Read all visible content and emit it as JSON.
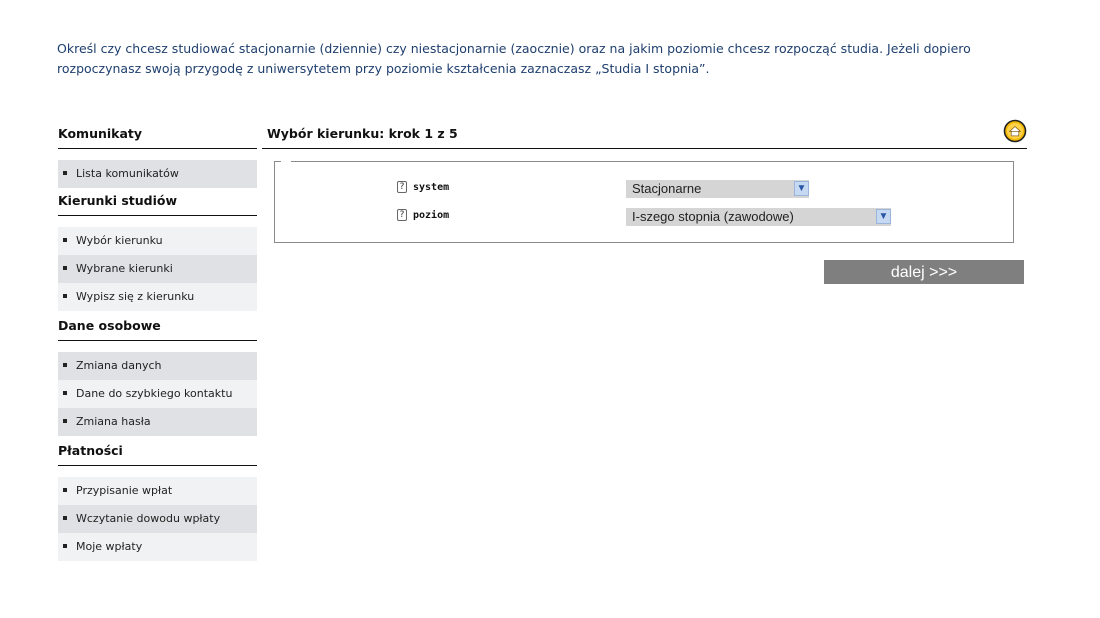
{
  "intro": {
    "line1": "Określ czy chcesz studiować stacjonarnie (dziennie) czy niestacjonarnie (zaocznie) oraz na jakim poziomie chcesz rozpocząć studia. Jeżeli dopiero",
    "line2": "rozpoczynasz swoją przygodę z uniwersytetem przy poziomie kształcenia zaznaczasz „Studia I stopnia”."
  },
  "sidebar": {
    "sections": [
      {
        "title": "Komunikaty",
        "items": [
          "Lista komunikatów"
        ]
      },
      {
        "title": "Kierunki studiów",
        "items": [
          "Wybór kierunku",
          "Wybrane kierunki",
          "Wypisz się z kierunku"
        ]
      },
      {
        "title": "Dane osobowe",
        "items": [
          "Zmiana danych",
          "Dane do szybkiego kontaktu",
          "Zmiana hasła"
        ]
      },
      {
        "title": "Płatności",
        "items": [
          "Przypisanie wpłat",
          "Wczytanie dowodu wpłaty",
          "Moje wpłaty"
        ]
      }
    ]
  },
  "main": {
    "title": "Wybór kierunku: krok 1 z 5",
    "home_icon": "home-icon",
    "help_icon_glyph": "?",
    "fields": {
      "system": {
        "label": "system",
        "value": "Stacjonarne"
      },
      "poziom": {
        "label": "poziom",
        "value": "I-szego stopnia (zawodowe)"
      }
    },
    "next_label": "dalej >>>"
  },
  "colors": {
    "intro_text": "#1f3f6e",
    "nav_dark": "#dfe1e4",
    "nav_light": "#f1f2f4",
    "button_bg": "#7f7f7f",
    "home_icon": "#f0a800"
  }
}
